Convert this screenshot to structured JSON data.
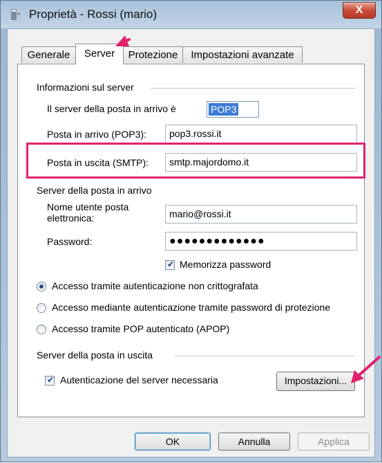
{
  "window": {
    "title": "Proprietà - Rossi (mario)",
    "close_label": "X"
  },
  "tabs": [
    {
      "label": "Generale",
      "active": false
    },
    {
      "label": "Server",
      "active": true
    },
    {
      "label": "Protezione",
      "active": false
    },
    {
      "label": "Impostazioni avanzate",
      "active": false
    }
  ],
  "server_info": {
    "group_label": "Informazioni sul server",
    "incoming_type_label": "Il server della posta in arrivo è",
    "incoming_type_value": "POP3",
    "incoming_label": "Posta in arrivo (POP3):",
    "incoming_value": "pop3.rossi.it",
    "outgoing_label": "Posta in uscita (SMTP):",
    "outgoing_value": "smtp.majordomo.it"
  },
  "incoming_server": {
    "group_label": "Server della posta in arrivo",
    "username_label": "Nome utente posta elettronica:",
    "username_value": "mario@rossi.it",
    "password_label": "Password:",
    "password_value": "●●●●●●●●●●●●●",
    "remember_label": "Memorizza password",
    "remember_checked": true
  },
  "auth_options": [
    {
      "label": "Accesso tramite autenticazione non crittografata",
      "selected": true
    },
    {
      "label": "Accesso mediante autenticazione tramite password di protezione",
      "selected": false
    },
    {
      "label": "Accesso tramite POP autenticato (APOP)",
      "selected": false
    }
  ],
  "outgoing_server": {
    "group_label": "Server della posta in uscita",
    "auth_required_label": "Autenticazione del server necessaria",
    "auth_required_checked": true,
    "settings_button": "Impostazioni..."
  },
  "footer": {
    "ok": "OK",
    "cancel": "Annulla",
    "apply": "Applica"
  },
  "annotations": {
    "highlight_color": "#e0236e",
    "arrow_color": "#e0236e"
  }
}
